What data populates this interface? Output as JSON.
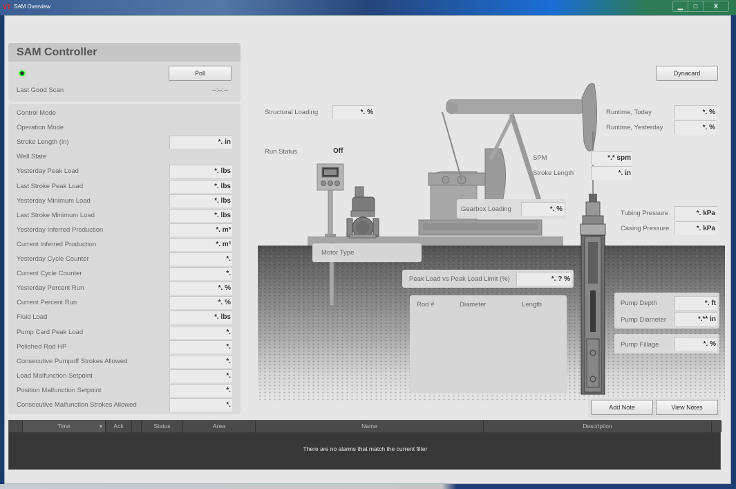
{
  "window": {
    "title": "SAM Overview",
    "app_icon": "vt-logo-icon",
    "controls": {
      "minimize": "▁",
      "maximize": "□",
      "close": "X"
    }
  },
  "controller": {
    "title": "SAM Controller",
    "status_led": {
      "icon": "green-led-icon",
      "color": "#33ee33"
    },
    "poll_label": "Poll",
    "last_good_scan_label": "Last Good Scan",
    "last_good_scan_value": "--:--:--",
    "rows": [
      {
        "label": "Control Mode",
        "value": null
      },
      {
        "label": "Operation Mode",
        "value": null
      },
      {
        "label": "Stroke Length (in)",
        "value": "*. in"
      },
      {
        "label": "Well State",
        "value": null
      },
      {
        "label": "Yesterday Peak Load",
        "value": "*. lbs"
      },
      {
        "label": "Last Stroke Peak Load",
        "value": "*. lbs"
      },
      {
        "label": "Yesterday Minimum Load",
        "value": "*. lbs"
      },
      {
        "label": "Last Stroke Minimum Load",
        "value": "*. lbs"
      },
      {
        "label": "Yesterday Inferred Production",
        "value": "*. m³"
      },
      {
        "label": "Current Inferred Production",
        "value": "*. m³"
      },
      {
        "label": "Yesterday Cycle Counter",
        "value": "*."
      },
      {
        "label": "Current Cycle Counter",
        "value": "*."
      },
      {
        "label": "Yesterday Percent Run",
        "value": "*. %"
      },
      {
        "label": "Current Percent Run",
        "value": "*. %"
      },
      {
        "label": "Fluid Load",
        "value": "*. lbs"
      },
      {
        "label": "Pump Card Peak Load",
        "value": "*."
      },
      {
        "label": "Polished Rod HP",
        "value": "*."
      },
      {
        "label": "Consecutive Pumpoff Strokes Allowed",
        "value": "*."
      },
      {
        "label": "Load Malfunction Setpoint",
        "value": "*."
      },
      {
        "label": "Position Malfunction Setpoint",
        "value": "*."
      },
      {
        "label": "Consecutive Malfunction Strokes Allowed",
        "value": "*."
      }
    ]
  },
  "scene": {
    "dynacard_label": "Dynacard",
    "structural_loading": {
      "label": "Structural Loading",
      "value": "*. %"
    },
    "run_status": {
      "label": "Run Status",
      "value": "Off"
    },
    "runtime_today": {
      "label": "Runtime, Today",
      "value": "*. %"
    },
    "runtime_yesterday": {
      "label": "Runtime, Yesterday",
      "value": "*. %"
    },
    "spm": {
      "label": "SPM",
      "value": "*.* spm"
    },
    "stroke_length": {
      "label": "Stroke Length",
      "value": "*. in"
    },
    "gearbox_loading": {
      "label": "Gearbox Loading",
      "value": "*. %"
    },
    "tubing_pressure": {
      "label": "Tubing Pressure",
      "value": "*. kPa"
    },
    "casing_pressure": {
      "label": "Casing Pressure",
      "value": "*. kPa"
    },
    "motor_type": {
      "label": "Motor Type"
    },
    "peak_load_limit": {
      "label": "Peak Load vs Peak Load Limit (%)",
      "value": "*. ? %"
    },
    "rod_table": {
      "columns": [
        "Rod #",
        "Diameter",
        "Length"
      ],
      "rows": []
    },
    "pump_depth": {
      "label": "Pump Depth",
      "value": "*. ft"
    },
    "pump_diameter": {
      "label": "Pump Diameter",
      "value": "*.** in"
    },
    "pump_fillage": {
      "label": "Pump Fillage",
      "value": "*. %"
    },
    "add_note_label": "Add Note",
    "view_notes_label": "View Notes"
  },
  "alarms": {
    "columns": [
      "",
      "Time",
      "Ack",
      "",
      "Status",
      "Area",
      "Name",
      "Description"
    ],
    "sort_icon": "▾",
    "empty_message": "There are no alarms that match the current filter"
  }
}
